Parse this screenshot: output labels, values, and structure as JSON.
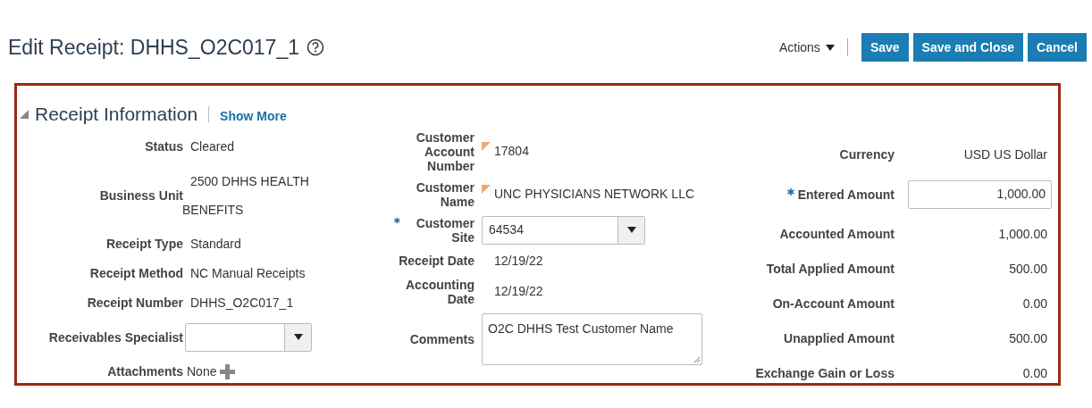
{
  "page_title": "Edit Receipt: DHHS_O2C017_1",
  "toolbar": {
    "actions_menu": "Actions",
    "buttons": [
      "Save",
      "Save and Close",
      "Cancel"
    ]
  },
  "section": {
    "title": "Receipt Information",
    "expanded": true,
    "link": "Show More"
  },
  "columns": [
    [
      {
        "kind": "text",
        "label": "Status",
        "value": "Cleared"
      },
      {
        "kind": "wrapped",
        "label": "Business Unit",
        "value": "2500 DHHS HEALTH BENEFITS"
      },
      {
        "kind": "text",
        "label": "Receipt Type",
        "value": "Standard"
      },
      {
        "kind": "text",
        "label": "Receipt Method",
        "value": "NC Manual Receipts"
      },
      {
        "kind": "text",
        "label": "Receipt Number",
        "value": "DHHS_O2C017_1"
      },
      {
        "kind": "select",
        "label": "Receivables Specialist"
      },
      {
        "kind": "attachment",
        "label": "Attachments",
        "value": "None"
      }
    ],
    [
      {
        "kind": "text",
        "label": "Customer Account Number",
        "value": "17804",
        "flagged": true
      },
      {
        "kind": "text",
        "label": "Customer Name",
        "value": "UNC PHYSICIANS NETWORK LLC",
        "flagged": true
      },
      {
        "kind": "select",
        "label": "Customer Site",
        "value": "64534",
        "required": true
      },
      {
        "kind": "text",
        "label": "Receipt Date",
        "value": "12/19/22"
      },
      {
        "kind": "text",
        "label": "Accounting Date",
        "value": "12/19/22"
      },
      {
        "kind": "textarea",
        "label": "Comments",
        "value": "O2C DHHS Test Customer Name"
      }
    ],
    [
      {
        "kind": "amount",
        "label": "Currency",
        "value": "USD US Dollar"
      },
      {
        "kind": "input",
        "label": "Entered Amount",
        "value": "1,000.00",
        "required": true
      },
      {
        "kind": "amount",
        "label": "Accounted Amount",
        "value": "1,000.00"
      },
      {
        "kind": "amount",
        "label": "Total Applied Amount",
        "value": "500.00"
      },
      {
        "kind": "amount",
        "label": "On-Account Amount",
        "value": "0.00"
      },
      {
        "kind": "amount",
        "label": "Unapplied Amount",
        "value": "500.00"
      },
      {
        "kind": "amount",
        "label": "Exchange Gain or Loss",
        "value": "0.00"
      }
    ]
  ]
}
